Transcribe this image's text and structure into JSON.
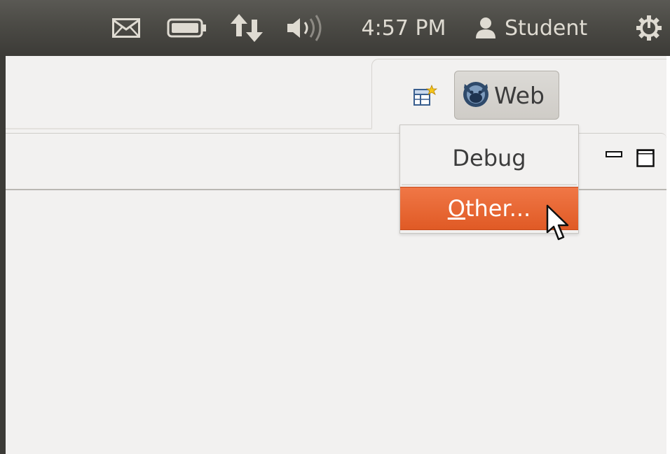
{
  "top_panel": {
    "icons": [
      "mail-icon",
      "battery-icon",
      "network-icon",
      "volume-icon",
      "user-icon",
      "power-gear-icon"
    ],
    "clock": "4:57 PM",
    "user_name": "Student",
    "colors": {
      "panel_bg": "#3c3b37",
      "panel_text": "#dfdbd2"
    }
  },
  "toolbar": {
    "open_perspective_icon": "open-perspective-icon",
    "web_perspective": {
      "icon": "web-perspective-icon",
      "label": "Web"
    }
  },
  "perspective_menu": {
    "items": [
      {
        "label": "Debug"
      },
      {
        "mnemonic": "O",
        "rest": "ther...",
        "highlighted": true
      }
    ],
    "colors": {
      "highlight": "#e95420"
    }
  },
  "view_controls": {
    "minimize_icon": "minimize-icon",
    "maximize_icon": "maximize-icon"
  }
}
